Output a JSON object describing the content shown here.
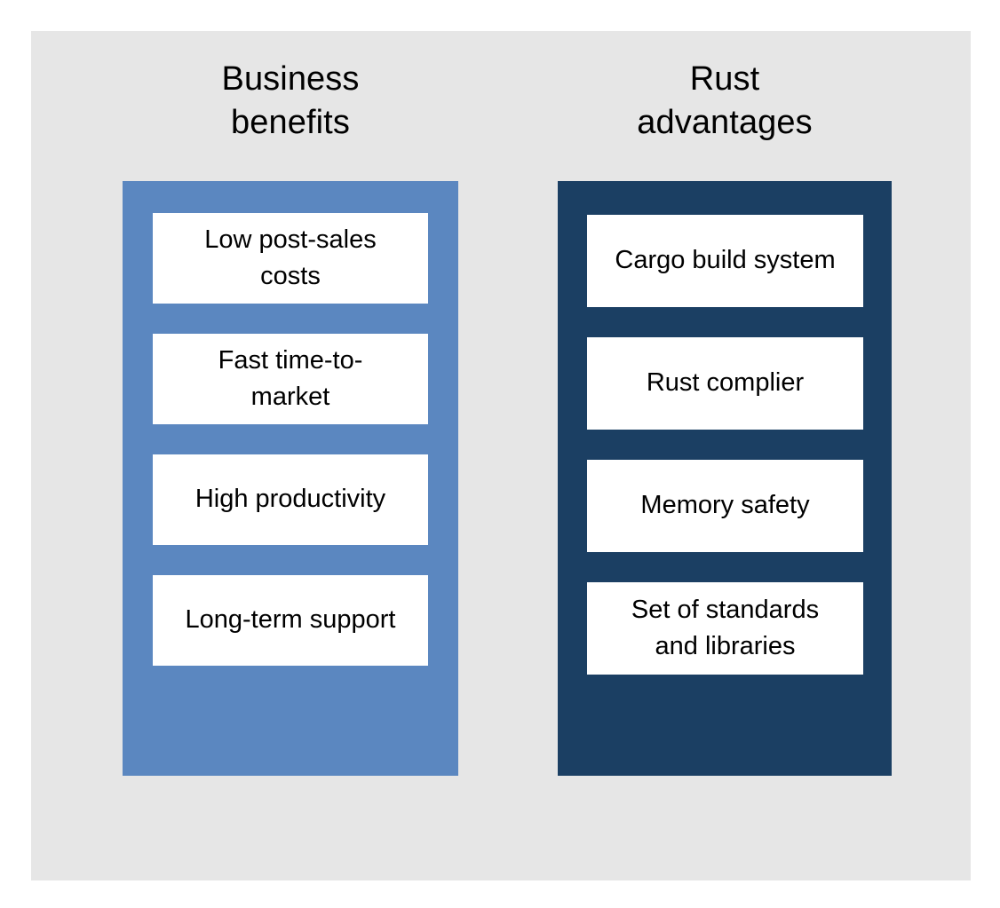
{
  "slide": {
    "background_color": "#e6e6e6",
    "page_background_color": "#ffffff"
  },
  "columns": [
    {
      "id": "business",
      "title": "Business\nbenefits",
      "panel_color": "#5b87c0",
      "card_color": "#ffffff",
      "text_color": "#000000",
      "items": [
        "Low post-sales\ncosts",
        "Fast time-to-\nmarket",
        "High productivity",
        "Long-term support"
      ]
    },
    {
      "id": "rust",
      "title": "Rust\nadvantages",
      "panel_color": "#1b3f63",
      "card_color": "#ffffff",
      "text_color": "#000000",
      "items": [
        "Cargo build system",
        "Rust complier",
        "Memory safety",
        "Set of standards\nand libraries"
      ]
    }
  ]
}
